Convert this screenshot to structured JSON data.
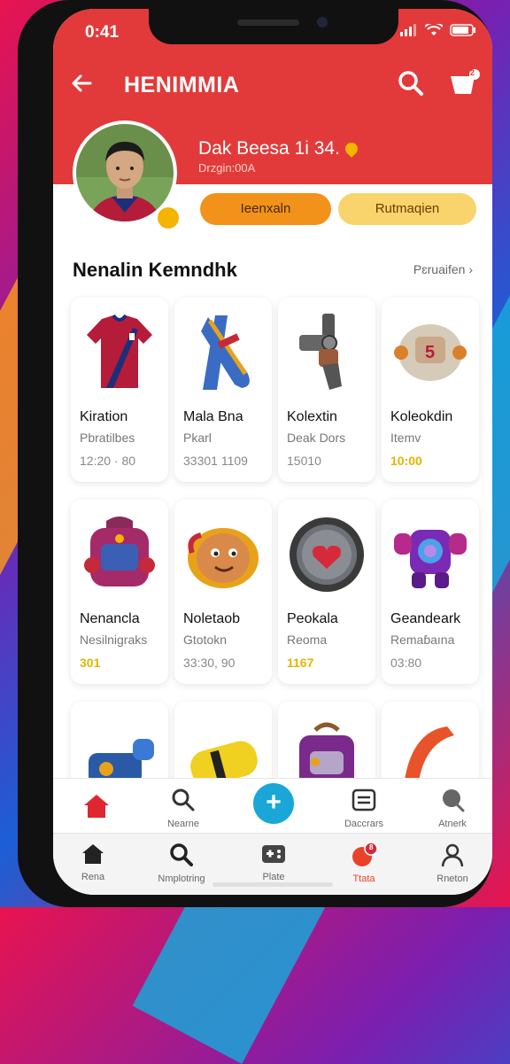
{
  "status": {
    "time": "0:41"
  },
  "header": {
    "title": "HENIMMIA",
    "cart_count": "2"
  },
  "profile": {
    "name": "Dak Beesa 1i 34.",
    "subtitle": "Drzgin:00A"
  },
  "actions": {
    "primary": "Ieenxaln",
    "secondary": "Rutmaqien"
  },
  "section": {
    "title": "Nenalin Kemndhk",
    "link": "Pɛruaifen"
  },
  "cards": [
    {
      "title": "Kiration",
      "sub": "Pbratilbes",
      "meta": "12:20 · 80",
      "gold": false,
      "icon": "jersey-icon"
    },
    {
      "title": "Mala Bna",
      "sub": "Pkarl",
      "meta": "33301 1109",
      "gold": false,
      "icon": "scarf-icon"
    },
    {
      "title": "Kolextin",
      "sub": "Deak Dors",
      "meta": "15010",
      "gold": false,
      "icon": "robot-arm-icon"
    },
    {
      "title": "Koleokdin",
      "sub": "Itemv",
      "meta": "10:00",
      "gold": true,
      "icon": "helmet-icon"
    },
    {
      "title": "Nenancla",
      "sub": "Nesilnigraks",
      "meta": "301",
      "gold": true,
      "icon": "backpack-icon"
    },
    {
      "title": "Noletaob",
      "sub": "Gtotokn",
      "meta": "33:30, 90",
      "gold": false,
      "icon": "mascot-icon"
    },
    {
      "title": "Peokala",
      "sub": "Reoma",
      "meta": "1167",
      "gold": true,
      "icon": "shield-icon"
    },
    {
      "title": "Geandeark",
      "sub": "Remaɓaına",
      "meta": "03:80",
      "gold": false,
      "icon": "armor-icon"
    },
    {
      "title": "",
      "sub": "",
      "meta": "",
      "gold": false,
      "icon": "blaster-icon"
    },
    {
      "title": "",
      "sub": "",
      "meta": "",
      "gold": false,
      "icon": "capsule-icon"
    },
    {
      "title": "",
      "sub": "",
      "meta": "",
      "gold": false,
      "icon": "bag-icon"
    },
    {
      "title": "",
      "sub": "",
      "meta": "",
      "gold": false,
      "icon": "strap-icon"
    }
  ],
  "navbar_top": [
    {
      "label": "",
      "icon": "home-icon"
    },
    {
      "label": "Nearne",
      "icon": "search-icon"
    },
    {
      "label": "",
      "icon": "plus-icon"
    },
    {
      "label": "Daccrars",
      "icon": "list-icon"
    },
    {
      "label": "Atnerk",
      "icon": "search-icon"
    }
  ],
  "navbar_bottom": [
    {
      "label": "Rena",
      "icon": "home-icon"
    },
    {
      "label": "Nmplotring",
      "icon": "search-icon"
    },
    {
      "label": "Plate",
      "icon": "gamepad-icon"
    },
    {
      "label": "Ttata",
      "icon": "notification-icon",
      "badge": "8"
    },
    {
      "label": "Rneton",
      "icon": "user-icon"
    }
  ],
  "colors": {
    "header_red": "#e23a3a",
    "accent_orange": "#f2921b",
    "accent_yellow": "#f9d36b",
    "fab_blue": "#1aa7d8",
    "gold_text": "#e3b500"
  }
}
